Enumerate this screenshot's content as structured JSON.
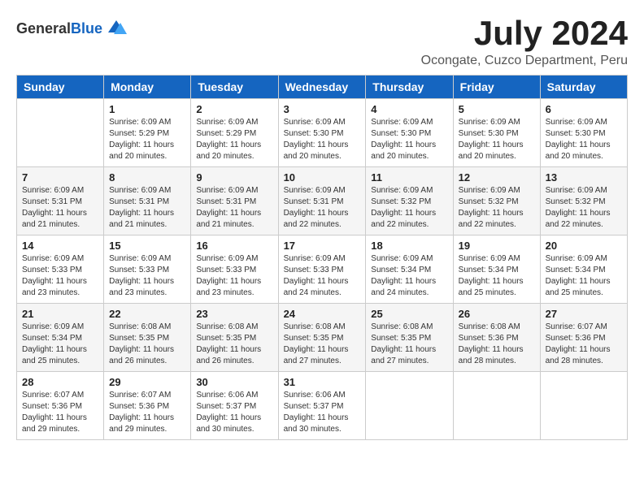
{
  "header": {
    "logo_general": "General",
    "logo_blue": "Blue",
    "title": "July 2024",
    "location": "Ocongate, Cuzco Department, Peru"
  },
  "days_of_week": [
    "Sunday",
    "Monday",
    "Tuesday",
    "Wednesday",
    "Thursday",
    "Friday",
    "Saturday"
  ],
  "weeks": [
    [
      {
        "day": "",
        "sunrise": "",
        "sunset": "",
        "daylight": ""
      },
      {
        "day": "1",
        "sunrise": "Sunrise: 6:09 AM",
        "sunset": "Sunset: 5:29 PM",
        "daylight": "Daylight: 11 hours and 20 minutes."
      },
      {
        "day": "2",
        "sunrise": "Sunrise: 6:09 AM",
        "sunset": "Sunset: 5:29 PM",
        "daylight": "Daylight: 11 hours and 20 minutes."
      },
      {
        "day": "3",
        "sunrise": "Sunrise: 6:09 AM",
        "sunset": "Sunset: 5:30 PM",
        "daylight": "Daylight: 11 hours and 20 minutes."
      },
      {
        "day": "4",
        "sunrise": "Sunrise: 6:09 AM",
        "sunset": "Sunset: 5:30 PM",
        "daylight": "Daylight: 11 hours and 20 minutes."
      },
      {
        "day": "5",
        "sunrise": "Sunrise: 6:09 AM",
        "sunset": "Sunset: 5:30 PM",
        "daylight": "Daylight: 11 hours and 20 minutes."
      },
      {
        "day": "6",
        "sunrise": "Sunrise: 6:09 AM",
        "sunset": "Sunset: 5:30 PM",
        "daylight": "Daylight: 11 hours and 20 minutes."
      }
    ],
    [
      {
        "day": "7",
        "sunrise": "Sunrise: 6:09 AM",
        "sunset": "Sunset: 5:31 PM",
        "daylight": "Daylight: 11 hours and 21 minutes."
      },
      {
        "day": "8",
        "sunrise": "Sunrise: 6:09 AM",
        "sunset": "Sunset: 5:31 PM",
        "daylight": "Daylight: 11 hours and 21 minutes."
      },
      {
        "day": "9",
        "sunrise": "Sunrise: 6:09 AM",
        "sunset": "Sunset: 5:31 PM",
        "daylight": "Daylight: 11 hours and 21 minutes."
      },
      {
        "day": "10",
        "sunrise": "Sunrise: 6:09 AM",
        "sunset": "Sunset: 5:31 PM",
        "daylight": "Daylight: 11 hours and 22 minutes."
      },
      {
        "day": "11",
        "sunrise": "Sunrise: 6:09 AM",
        "sunset": "Sunset: 5:32 PM",
        "daylight": "Daylight: 11 hours and 22 minutes."
      },
      {
        "day": "12",
        "sunrise": "Sunrise: 6:09 AM",
        "sunset": "Sunset: 5:32 PM",
        "daylight": "Daylight: 11 hours and 22 minutes."
      },
      {
        "day": "13",
        "sunrise": "Sunrise: 6:09 AM",
        "sunset": "Sunset: 5:32 PM",
        "daylight": "Daylight: 11 hours and 22 minutes."
      }
    ],
    [
      {
        "day": "14",
        "sunrise": "Sunrise: 6:09 AM",
        "sunset": "Sunset: 5:33 PM",
        "daylight": "Daylight: 11 hours and 23 minutes."
      },
      {
        "day": "15",
        "sunrise": "Sunrise: 6:09 AM",
        "sunset": "Sunset: 5:33 PM",
        "daylight": "Daylight: 11 hours and 23 minutes."
      },
      {
        "day": "16",
        "sunrise": "Sunrise: 6:09 AM",
        "sunset": "Sunset: 5:33 PM",
        "daylight": "Daylight: 11 hours and 23 minutes."
      },
      {
        "day": "17",
        "sunrise": "Sunrise: 6:09 AM",
        "sunset": "Sunset: 5:33 PM",
        "daylight": "Daylight: 11 hours and 24 minutes."
      },
      {
        "day": "18",
        "sunrise": "Sunrise: 6:09 AM",
        "sunset": "Sunset: 5:34 PM",
        "daylight": "Daylight: 11 hours and 24 minutes."
      },
      {
        "day": "19",
        "sunrise": "Sunrise: 6:09 AM",
        "sunset": "Sunset: 5:34 PM",
        "daylight": "Daylight: 11 hours and 25 minutes."
      },
      {
        "day": "20",
        "sunrise": "Sunrise: 6:09 AM",
        "sunset": "Sunset: 5:34 PM",
        "daylight": "Daylight: 11 hours and 25 minutes."
      }
    ],
    [
      {
        "day": "21",
        "sunrise": "Sunrise: 6:09 AM",
        "sunset": "Sunset: 5:34 PM",
        "daylight": "Daylight: 11 hours and 25 minutes."
      },
      {
        "day": "22",
        "sunrise": "Sunrise: 6:08 AM",
        "sunset": "Sunset: 5:35 PM",
        "daylight": "Daylight: 11 hours and 26 minutes."
      },
      {
        "day": "23",
        "sunrise": "Sunrise: 6:08 AM",
        "sunset": "Sunset: 5:35 PM",
        "daylight": "Daylight: 11 hours and 26 minutes."
      },
      {
        "day": "24",
        "sunrise": "Sunrise: 6:08 AM",
        "sunset": "Sunset: 5:35 PM",
        "daylight": "Daylight: 11 hours and 27 minutes."
      },
      {
        "day": "25",
        "sunrise": "Sunrise: 6:08 AM",
        "sunset": "Sunset: 5:35 PM",
        "daylight": "Daylight: 11 hours and 27 minutes."
      },
      {
        "day": "26",
        "sunrise": "Sunrise: 6:08 AM",
        "sunset": "Sunset: 5:36 PM",
        "daylight": "Daylight: 11 hours and 28 minutes."
      },
      {
        "day": "27",
        "sunrise": "Sunrise: 6:07 AM",
        "sunset": "Sunset: 5:36 PM",
        "daylight": "Daylight: 11 hours and 28 minutes."
      }
    ],
    [
      {
        "day": "28",
        "sunrise": "Sunrise: 6:07 AM",
        "sunset": "Sunset: 5:36 PM",
        "daylight": "Daylight: 11 hours and 29 minutes."
      },
      {
        "day": "29",
        "sunrise": "Sunrise: 6:07 AM",
        "sunset": "Sunset: 5:36 PM",
        "daylight": "Daylight: 11 hours and 29 minutes."
      },
      {
        "day": "30",
        "sunrise": "Sunrise: 6:06 AM",
        "sunset": "Sunset: 5:37 PM",
        "daylight": "Daylight: 11 hours and 30 minutes."
      },
      {
        "day": "31",
        "sunrise": "Sunrise: 6:06 AM",
        "sunset": "Sunset: 5:37 PM",
        "daylight": "Daylight: 11 hours and 30 minutes."
      },
      {
        "day": "",
        "sunrise": "",
        "sunset": "",
        "daylight": ""
      },
      {
        "day": "",
        "sunrise": "",
        "sunset": "",
        "daylight": ""
      },
      {
        "day": "",
        "sunrise": "",
        "sunset": "",
        "daylight": ""
      }
    ]
  ]
}
